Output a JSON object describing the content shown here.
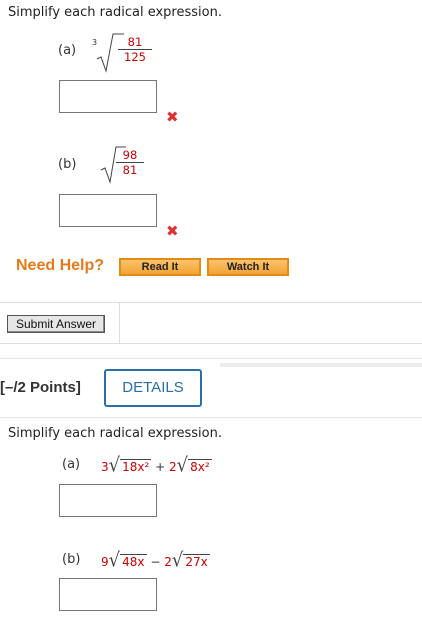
{
  "q1": {
    "instruction": "Simplify each radical expression.",
    "a": {
      "label": "(a)",
      "index": "3",
      "num": "81",
      "den": "125"
    },
    "b": {
      "label": "(b)",
      "num": "98",
      "den": "81"
    },
    "wrong_mark": "✖"
  },
  "help": {
    "need_help": "Need Help?",
    "read_it": "Read It",
    "watch_it": "Watch It"
  },
  "submit_label": "Submit Answer",
  "q2": {
    "points": "[–/2 Points]",
    "details": "DETAILS",
    "instruction": "Simplify each radical expression.",
    "a": {
      "label": "(a)",
      "coef1": "3",
      "rad1": "18x²",
      "op": "+",
      "coef2": "2",
      "rad2": "8x²"
    },
    "b": {
      "label": "(b)",
      "coef1": "9",
      "rad1": "48x",
      "op": "−",
      "coef2": "2",
      "rad2": "27x"
    }
  },
  "colors": {
    "accent_orange": "#e87a1a",
    "details_blue": "#2a6fa8",
    "wrong_red": "#d33"
  }
}
